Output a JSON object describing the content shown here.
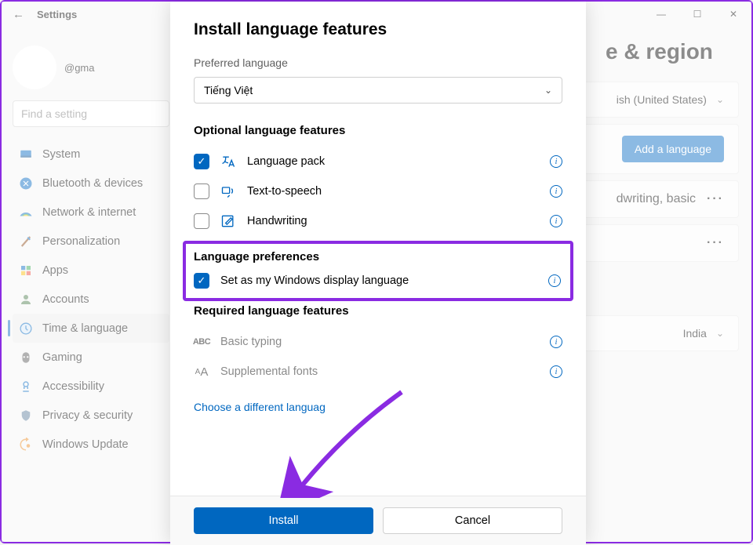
{
  "app": {
    "title": "Settings"
  },
  "user": {
    "email_suffix": "@gma"
  },
  "search": {
    "placeholder": "Find a setting"
  },
  "window_controls": {
    "min": "—",
    "max": "☐",
    "close": "✕"
  },
  "nav": [
    {
      "label": "System"
    },
    {
      "label": "Bluetooth & devices"
    },
    {
      "label": "Network & internet"
    },
    {
      "label": "Personalization"
    },
    {
      "label": "Apps"
    },
    {
      "label": "Accounts"
    },
    {
      "label": "Time & language"
    },
    {
      "label": "Gaming"
    },
    {
      "label": "Accessibility"
    },
    {
      "label": "Privacy & security"
    },
    {
      "label": "Windows Update"
    }
  ],
  "page": {
    "title_partial": "e & region",
    "display_lang": "ish (United States)",
    "add_btn": "Add a language",
    "lang_feat": "dwriting, basic",
    "region": "India"
  },
  "dialog": {
    "title": "Install language features",
    "pref_label": "Preferred language",
    "selected_lang": "Tiếng Việt",
    "optional_h": "Optional language features",
    "opt_langpack": "Language pack",
    "opt_tts": "Text-to-speech",
    "opt_hw": "Handwriting",
    "prefs_h": "Language preferences",
    "set_display": "Set as my Windows display language",
    "required_h": "Required language features",
    "basic_typing": "Basic typing",
    "supp_fonts": "Supplemental fonts",
    "choose_diff": "Choose a different languag",
    "install": "Install",
    "cancel": "Cancel"
  }
}
